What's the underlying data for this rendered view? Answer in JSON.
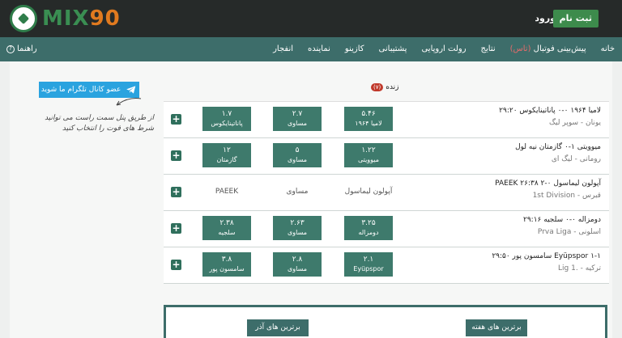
{
  "brand": {
    "logo_mix": "MIX",
    "logo_num": "90"
  },
  "header": {
    "register": "ثبت نام",
    "login": "ورود"
  },
  "nav": {
    "items": [
      {
        "label": "خانه"
      },
      {
        "label": "پیش‌بینی فوتبال",
        "badge": "(تاس)"
      },
      {
        "label": "نتایج"
      },
      {
        "label": "رولت اروپایی"
      },
      {
        "label": "پشتیبانی"
      },
      {
        "label": "کازینو"
      },
      {
        "label": "نماینده"
      },
      {
        "label": "انفجار"
      }
    ],
    "help": "راهنما"
  },
  "telegram": {
    "label": "عضو کانال تلگرام ما شوید"
  },
  "note": "از طریق پنل سمت راست می توانید شرط های فوت را انتخاب کنید",
  "live": {
    "label": "زنده",
    "badge": "(۷)"
  },
  "matches": [
    {
      "title": "لامیا ۱۹۶۴ ۰-۰ پاناتینایکوس ۲۹:۲۰",
      "league": "یونان - سوپر لیگ",
      "odds": [
        {
          "value": "۱.۷",
          "label": "پاناتینایکوس"
        },
        {
          "value": "۲.۷",
          "label": "مساوی"
        },
        {
          "value": "۵.۴۶",
          "label": "لامیا ۱۹۶۴"
        }
      ]
    },
    {
      "title": "میوویتی ۱-۰ گازمتان نیه لول",
      "league": "رومانی - لیگ ای",
      "odds": [
        {
          "value": "۱۲",
          "label": "گازمتان"
        },
        {
          "value": "۵",
          "label": "مساوی"
        },
        {
          "value": "۱.۲۲",
          "label": "میوویتی"
        }
      ]
    },
    {
      "title": "آپولون لیماسول ۰-۲ PAEEK ۲۶:۳۸",
      "league": "قبرس - 1st Division",
      "odds": [
        {
          "value": "",
          "label": "PAEEK"
        },
        {
          "value": "",
          "label": "مساوی"
        },
        {
          "value": "",
          "label": "آپولون لیماسول"
        }
      ]
    },
    {
      "title": "دومزاله ۰-۰ سلجیه ۲۹:۱۶",
      "league": "اسلونی - Prva Liga",
      "odds": [
        {
          "value": "۲.۳۸",
          "label": "سلجیه"
        },
        {
          "value": "۲.۶۳",
          "label": "مساوی"
        },
        {
          "value": "۳.۲۵",
          "label": "دومزاله"
        }
      ]
    },
    {
      "title": "Eyüpspor ۱-۱ سامسون پور ۲۹:۵۰",
      "league": "ترکیه - .1 Lig",
      "odds": [
        {
          "value": "۳.۸",
          "label": "سامسون پور"
        },
        {
          "value": "۲.۸",
          "label": "مساوی"
        },
        {
          "value": "۲.۱",
          "label": "Eyüpspor"
        }
      ]
    }
  ],
  "bottom": {
    "week": "برترین های هفته",
    "last": "برترین های آذر"
  }
}
